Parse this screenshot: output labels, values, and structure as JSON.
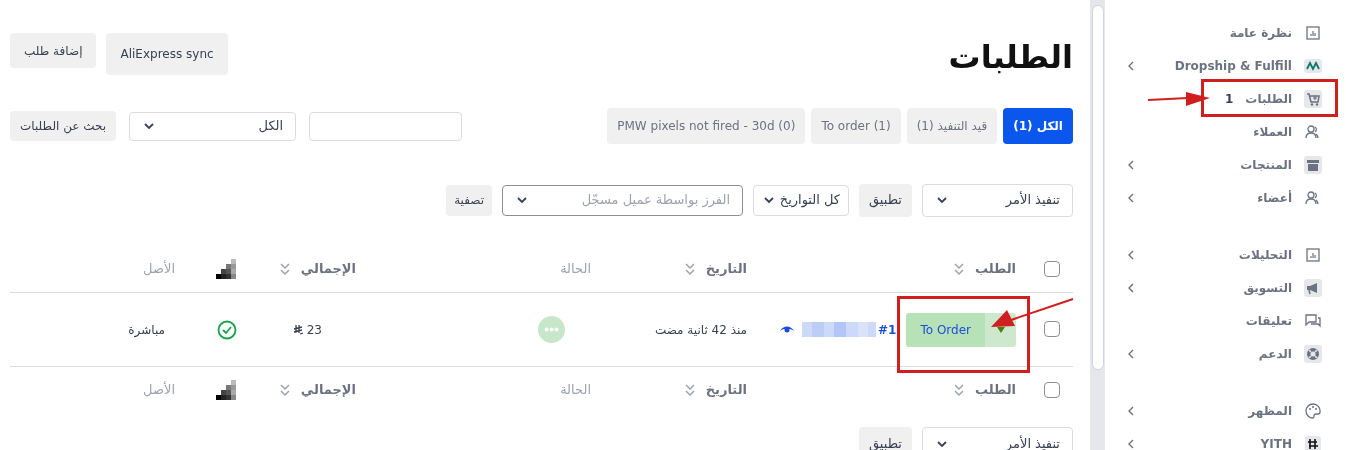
{
  "page_title": "الطلبات",
  "header_buttons": [
    "AliExpress sync",
    "إضافة طلب"
  ],
  "filter_tabs": [
    {
      "label": "الكل (1)",
      "selected": true
    },
    {
      "label": "قيد التنفيذ (1)",
      "selected": false
    },
    {
      "label": "To order (1)",
      "selected": false
    },
    {
      "label": "PMW pixels not fired - 30d (0)",
      "selected": false
    }
  ],
  "search": {
    "status_select": "الكل",
    "button": "بحث عن الطلبات"
  },
  "filters": {
    "bulk_action": "تنفيذ الأمر",
    "apply": "تطبيق",
    "dates": "كل التواريخ",
    "customer_placeholder": "الفرز بواسطة عميل مسجّل",
    "filter_button": "تصفية"
  },
  "table": {
    "header": {
      "checked": false,
      "columns": [
        {
          "label": "الطلب",
          "sortable": true
        },
        {
          "label": "التاريخ",
          "sortable": true
        },
        {
          "label": "الحالة",
          "sortable": false
        },
        {
          "label": "الإجمالي",
          "sortable": true
        },
        {
          "kind": "icon"
        },
        {
          "label": "الأصل",
          "sortable": false
        }
      ]
    },
    "rows": [
      {
        "checked": false,
        "action": "To Order",
        "order_number": "#1",
        "date": "منذ 42 ثانية مضت",
        "total": "23",
        "pixel_fired": true,
        "origin": "مباشرة"
      }
    ],
    "footer": {
      "checked": false,
      "columns": [
        {
          "label": "الطلب",
          "sortable": true
        },
        {
          "label": "التاريخ",
          "sortable": true
        },
        {
          "label": "الحالة",
          "sortable": false
        },
        {
          "label": "الإجمالي",
          "sortable": true
        },
        {
          "kind": "icon"
        },
        {
          "label": "الأصل",
          "sortable": false
        }
      ]
    }
  },
  "bottom_actions": {
    "bulk_action": "تنفيذ الأمر",
    "apply": "تطبيق"
  },
  "sidebar": {
    "items": [
      {
        "label": "نظرة عامة",
        "kind": "chart",
        "expandable": false
      },
      {
        "label": "Dropship & Fulfill",
        "kind": "dropship",
        "expandable": true
      },
      {
        "label": "الطلبات",
        "kind": "cart",
        "expandable": false,
        "badge": "1"
      },
      {
        "label": "العملاء",
        "kind": "users",
        "expandable": false
      },
      {
        "label": "المنتجات",
        "kind": "archive",
        "expandable": true
      },
      {
        "label": "أعضاء",
        "kind": "users",
        "expandable": true
      },
      {
        "kind": "gap"
      },
      {
        "label": "التحليلات",
        "kind": "chart",
        "expandable": true
      },
      {
        "label": "التسويق",
        "kind": "megaphone",
        "expandable": true
      },
      {
        "label": "تعليقات",
        "kind": "comments",
        "expandable": false
      },
      {
        "label": "الدعم",
        "kind": "support",
        "expandable": true
      },
      {
        "kind": "gap"
      },
      {
        "label": "المظهر",
        "kind": "palette",
        "expandable": true
      },
      {
        "label": "YITH",
        "kind": "yith",
        "expandable": true
      }
    ]
  }
}
